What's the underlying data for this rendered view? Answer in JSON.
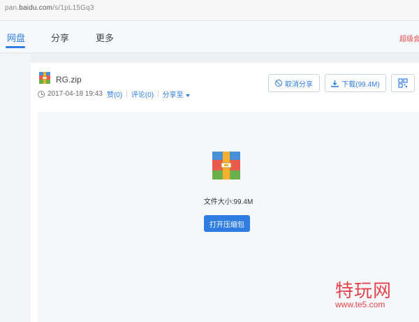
{
  "url": {
    "host_prefix": "pan.",
    "host": "baidu.com",
    "path": "/s/1pL15Gq3"
  },
  "nav": {
    "tabs": [
      {
        "label": "网盘",
        "active": true
      },
      {
        "label": "分享",
        "active": false
      },
      {
        "label": "更多",
        "active": false
      }
    ],
    "right_link": "超级会员"
  },
  "file": {
    "name": "RG.zip",
    "date": "2017-04-18 19:43",
    "like": "赞(0)",
    "comment": "评论(0)",
    "share_to": "分享至"
  },
  "actions": {
    "cancel_share": "取消分享",
    "download": "下载(99.4M)"
  },
  "preview": {
    "size_text": "文件大小:99.4M",
    "open_button": "打开压缩包"
  },
  "watermark": {
    "text": "特玩网",
    "url": "www.te5.com"
  },
  "colors": {
    "accent": "#2f7de1",
    "watermark": "#e0353a"
  }
}
